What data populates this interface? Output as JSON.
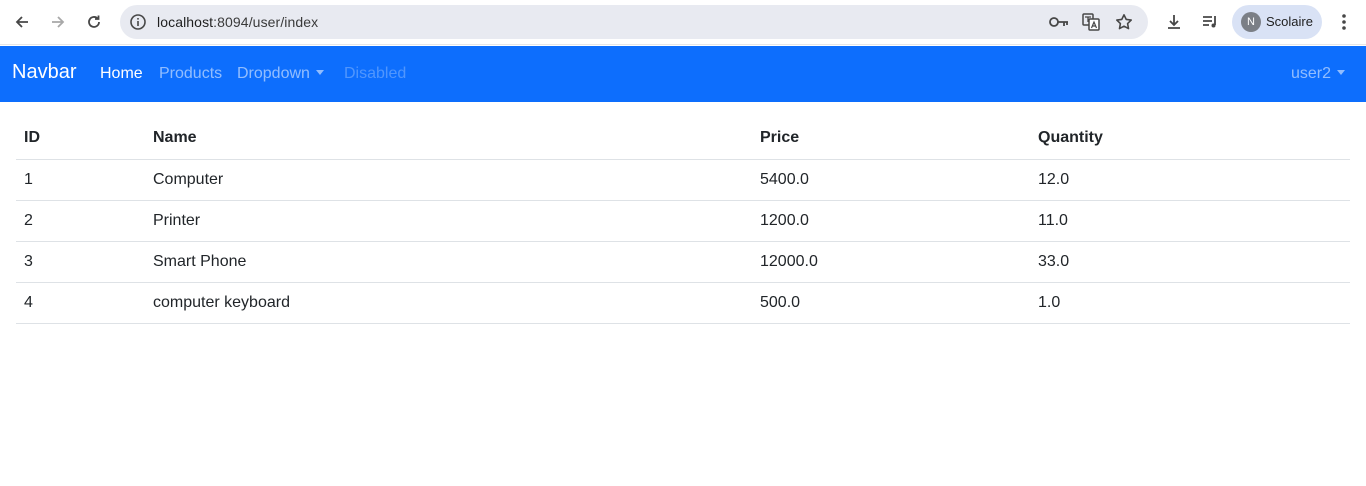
{
  "browser": {
    "url_host": "localhost",
    "url_rest": ":8094/user/index",
    "profile_initial": "N",
    "profile_name": "Scolaire"
  },
  "navbar": {
    "brand": "Navbar",
    "links": [
      {
        "label": "Home",
        "state": "active"
      },
      {
        "label": "Products",
        "state": "normal"
      },
      {
        "label": "Dropdown",
        "state": "dropdown"
      },
      {
        "label": "Disabled",
        "state": "disabled"
      }
    ],
    "user_menu": "user2"
  },
  "table": {
    "headers": [
      "ID",
      "Name",
      "Price",
      "Quantity"
    ],
    "rows": [
      [
        "1",
        "Computer",
        "5400.0",
        "12.0"
      ],
      [
        "2",
        "Printer",
        "1200.0",
        "11.0"
      ],
      [
        "3",
        "Smart Phone",
        "12000.0",
        "33.0"
      ],
      [
        "4",
        "computer keyboard",
        "500.0",
        "1.0"
      ]
    ]
  },
  "colors": {
    "navbar_bg": "#0d6efd",
    "omnibox_bg": "#e8eaf1",
    "profile_bg": "#d9e2f5"
  }
}
